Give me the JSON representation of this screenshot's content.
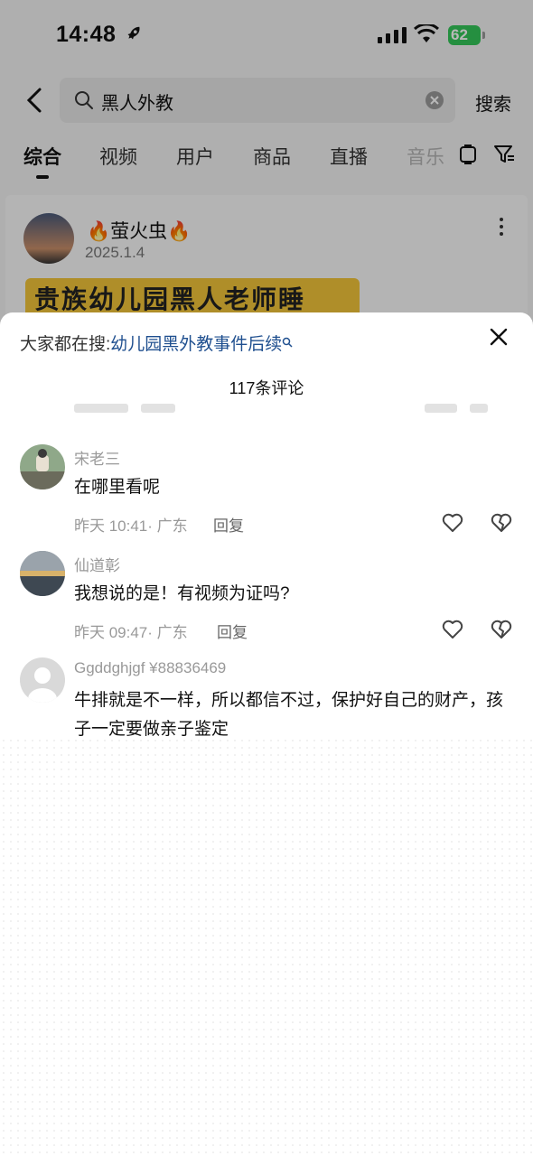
{
  "status_bar": {
    "time": "14:48",
    "battery": "62"
  },
  "search": {
    "query": "黑人外教",
    "button_label": "搜索"
  },
  "tabs": [
    {
      "label": "综合"
    },
    {
      "label": "视频"
    },
    {
      "label": "用户"
    },
    {
      "label": "商品"
    },
    {
      "label": "直播"
    },
    {
      "label": "音乐"
    }
  ],
  "post": {
    "author": "🔥萤火虫🔥",
    "date": "2025.1.4",
    "banner_text": "贵族幼儿园黑人老师睡"
  },
  "comments_sheet": {
    "suggest_prefix": "大家都在搜:",
    "suggest_link": "幼儿园黑外教事件后续",
    "count_label": "117条评论",
    "comments": [
      {
        "name": "宋老三",
        "text": "在哪里看呢",
        "meta": "昨天 10:41· 广东",
        "reply": "回复"
      },
      {
        "name": "仙道彰",
        "text": "我想说的是！有视频为证吗?",
        "meta": "昨天 09:47· 广东",
        "reply": "回复"
      },
      {
        "name": "Ggddghjgf ¥88836469",
        "text": "牛排就是不一样，所以都信不过，保护好自己的财产，孩子一定要做亲子鉴定"
      }
    ]
  },
  "colors": {
    "accent_link": "#1f4f8f",
    "battery": "#34c759",
    "banner": "#f3c53a"
  }
}
